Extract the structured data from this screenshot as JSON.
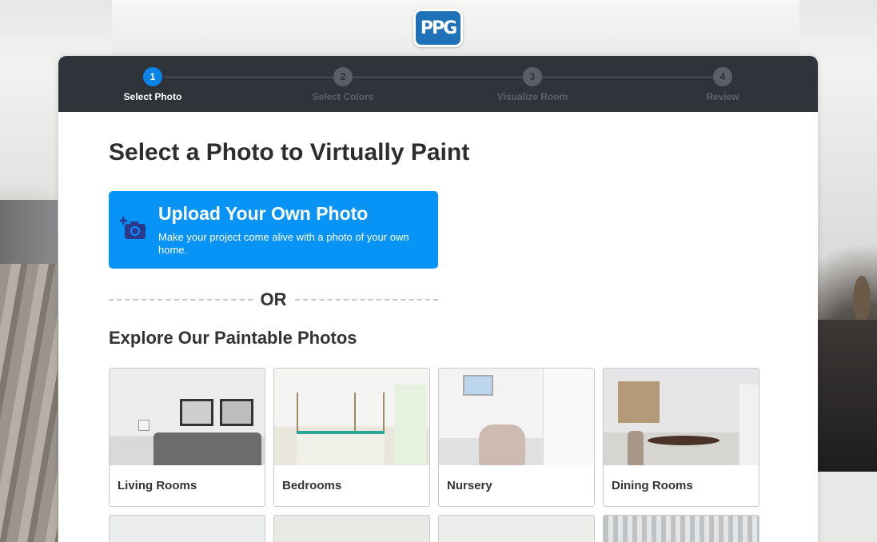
{
  "brand": {
    "logo_text": "PPG",
    "logo_color": "#1f72b8"
  },
  "stepper": {
    "steps": [
      {
        "number": "1",
        "label": "Select Photo",
        "active": true
      },
      {
        "number": "2",
        "label": "Select Colors",
        "active": false
      },
      {
        "number": "3",
        "label": "Visualize Room",
        "active": false
      },
      {
        "number": "4",
        "label": "Review",
        "active": false
      }
    ],
    "active_color": "#0a84e6"
  },
  "main": {
    "title": "Select a Photo to Virtually Paint",
    "upload": {
      "title": "Upload Your Own Photo",
      "subtitle": "Make your project come alive with a photo of your own home.",
      "icon": "add-photo-camera-icon",
      "color": "#0894f7"
    },
    "divider_text": "OR",
    "explore_title": "Explore Our Paintable Photos",
    "categories": [
      {
        "label": "Living Rooms"
      },
      {
        "label": "Bedrooms"
      },
      {
        "label": "Nursery"
      },
      {
        "label": "Dining Rooms"
      }
    ]
  }
}
